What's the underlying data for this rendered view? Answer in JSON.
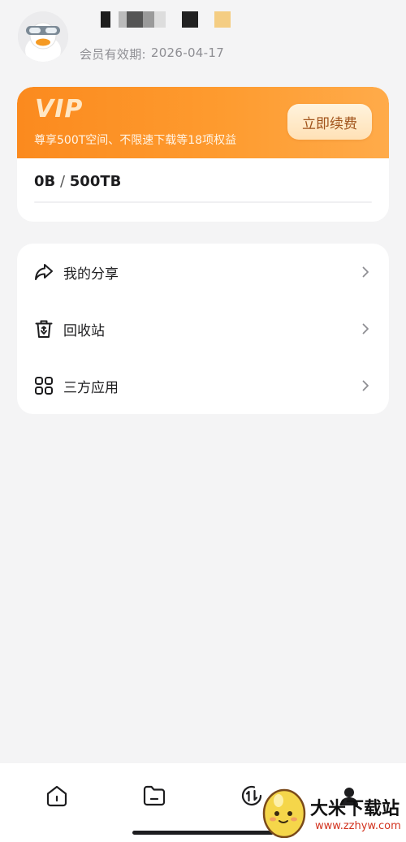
{
  "profile": {
    "avatar_icon": "duck-avatar-icon",
    "username_mask_colors": [
      "#1e1e1e",
      "#bbbbbb",
      "#555555",
      "#9a9a9a",
      "#dddddd",
      "#222222",
      "#f4cd83"
    ],
    "membership_label": "会员有效期:",
    "membership_date": "2026-04-17"
  },
  "vip": {
    "title": "VIP",
    "subtitle": "尊享500T空间、不限速下载等18项权益",
    "renew_label": "立即续费",
    "storage_used": "0B",
    "storage_separator": " / ",
    "storage_total": "500TB",
    "usage_fraction": 0,
    "accent": "#fb8a1e"
  },
  "menu": {
    "items": [
      {
        "label": "我的分享",
        "icon": "share-icon"
      },
      {
        "label": "回收站",
        "icon": "trash-icon"
      },
      {
        "label": "三方应用",
        "icon": "apps-grid-icon"
      }
    ]
  },
  "tabbar": {
    "tabs": [
      {
        "icon": "home-icon"
      },
      {
        "icon": "folder-icon"
      },
      {
        "icon": "transfer-icon"
      },
      {
        "icon": "profile-icon"
      }
    ]
  },
  "watermark": {
    "name": "大米下载站",
    "url": "www.zzhyw.com"
  }
}
